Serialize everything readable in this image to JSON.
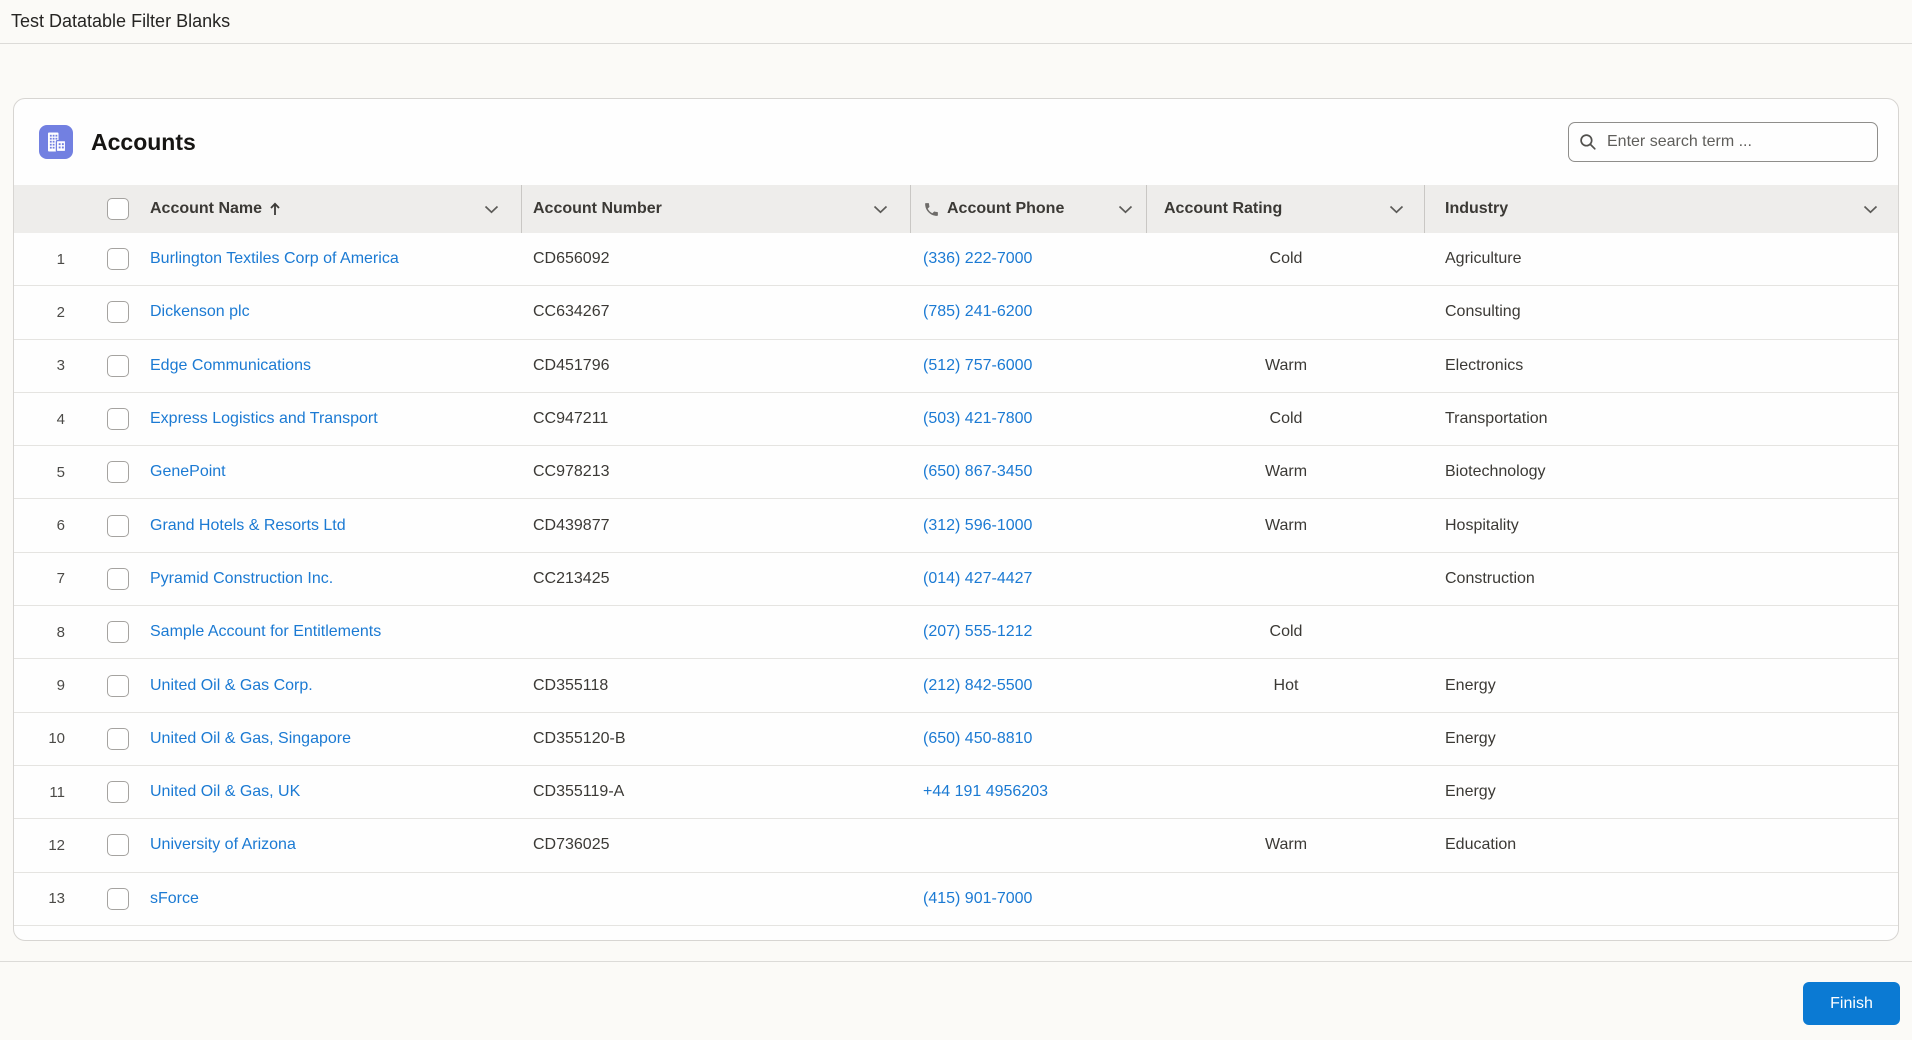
{
  "page": {
    "title": "Test Datatable Filter Blanks"
  },
  "card": {
    "title": "Accounts",
    "icon": "accounts-object-icon",
    "search": {
      "placeholder": "Enter search term ..."
    }
  },
  "table": {
    "columns": [
      {
        "label": "Account Name",
        "sorted": "ascending"
      },
      {
        "label": "Account Number"
      },
      {
        "label": "Account Phone",
        "icon": "phone-icon"
      },
      {
        "label": "Account Rating"
      },
      {
        "label": "Industry"
      }
    ],
    "rows": [
      {
        "num": "1",
        "name": "Burlington Textiles Corp of America",
        "number": "CD656092",
        "phone": "(336) 222-7000",
        "rating": "Cold",
        "industry": "Agriculture"
      },
      {
        "num": "2",
        "name": "Dickenson plc",
        "number": "CC634267",
        "phone": "(785) 241-6200",
        "rating": "",
        "industry": "Consulting"
      },
      {
        "num": "3",
        "name": "Edge Communications",
        "number": "CD451796",
        "phone": "(512) 757-6000",
        "rating": "Warm",
        "industry": "Electronics"
      },
      {
        "num": "4",
        "name": "Express Logistics and Transport",
        "number": "CC947211",
        "phone": "(503) 421-7800",
        "rating": "Cold",
        "industry": "Transportation"
      },
      {
        "num": "5",
        "name": "GenePoint",
        "number": "CC978213",
        "phone": "(650) 867-3450",
        "rating": "Warm",
        "industry": "Biotechnology"
      },
      {
        "num": "6",
        "name": "Grand Hotels & Resorts Ltd",
        "number": "CD439877",
        "phone": "(312) 596-1000",
        "rating": "Warm",
        "industry": "Hospitality"
      },
      {
        "num": "7",
        "name": "Pyramid Construction Inc.",
        "number": "CC213425",
        "phone": "(014) 427-4427",
        "rating": "",
        "industry": "Construction"
      },
      {
        "num": "8",
        "name": "Sample Account for Entitlements",
        "number": "",
        "phone": "(207) 555-1212",
        "rating": "Cold",
        "industry": ""
      },
      {
        "num": "9",
        "name": "United Oil & Gas Corp.",
        "number": "CD355118",
        "phone": "(212) 842-5500",
        "rating": "Hot",
        "industry": "Energy"
      },
      {
        "num": "10",
        "name": "United Oil & Gas, Singapore",
        "number": "CD355120-B",
        "phone": "(650) 450-8810",
        "rating": "",
        "industry": "Energy"
      },
      {
        "num": "11",
        "name": "United Oil & Gas, UK",
        "number": "CD355119-A",
        "phone": "+44 191 4956203",
        "rating": "",
        "industry": "Energy"
      },
      {
        "num": "12",
        "name": "University of Arizona",
        "number": "CD736025",
        "phone": "",
        "rating": "Warm",
        "industry": "Education"
      },
      {
        "num": "13",
        "name": "sForce",
        "number": "",
        "phone": "(415) 901-7000",
        "rating": "",
        "industry": ""
      }
    ]
  },
  "footer": {
    "finish_label": "Finish"
  },
  "colors": {
    "icon_background": "#7280e1",
    "link_blue": "#1b7ad3",
    "button_blue": "#0b7ad3",
    "header_band": "#eeedeb"
  }
}
